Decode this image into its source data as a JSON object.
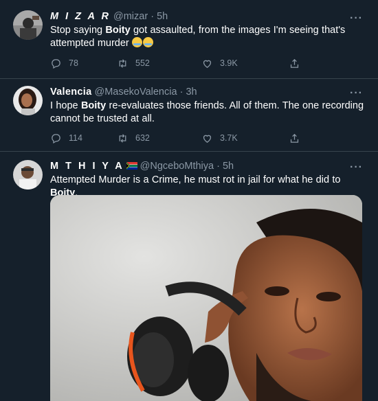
{
  "tweets": [
    {
      "name": "M I Z A R",
      "handle": "@mizar",
      "separator": "·",
      "time": "5h",
      "text_parts": [
        "Stop saying ",
        "Boity",
        " got assaulted, from the images I'm seeing that's attempted murder "
      ],
      "emoji": "crying-face-emoji",
      "replies": "78",
      "retweets": "552",
      "likes": "3.9K"
    },
    {
      "name": "Valencia",
      "handle": "@MasekoValencia",
      "separator": "·",
      "time": "3h",
      "text_parts": [
        "I hope ",
        "Boity",
        " re-evaluates those friends. All of them. The one recording cannot be trusted at all."
      ],
      "replies": "114",
      "retweets": "632",
      "likes": "3.7K"
    },
    {
      "name": "M T H I Y A",
      "flag": "south-africa-flag-icon",
      "handle": "@NgceboMthiya",
      "separator": "·",
      "time": "5h",
      "text_parts": [
        "Attempted Murder is a Crime, he must rot in jail for what he did to ",
        "Boity",
        "."
      ]
    }
  ],
  "more_label": "···",
  "colors": {
    "background": "#15202b",
    "divider": "#38444d",
    "secondary_text": "#8b98a5",
    "primary_text": "#ffffff"
  },
  "icons": [
    "reply-icon",
    "retweet-icon",
    "like-icon",
    "share-icon",
    "more-icon"
  ]
}
